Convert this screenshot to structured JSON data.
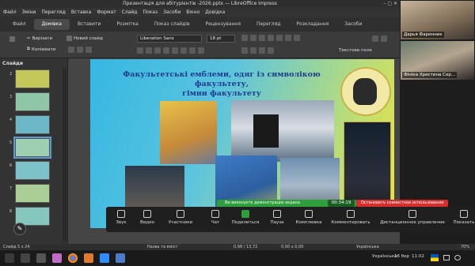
{
  "window": {
    "title": "Презентація для абітурієнтів -2026.pptx — LibreOffice Impress",
    "controls": "–  ▢  ✕"
  },
  "menu": [
    "Файл",
    "Зміни",
    "Перегляд",
    "Вставка",
    "Формат",
    "Слайд",
    "Показ",
    "Засоби",
    "Вікно",
    "Довідка"
  ],
  "tabs": [
    "Файл",
    "Домівка",
    "Вставити",
    "Розмітка",
    "Показ слайдів",
    "Рецензування",
    "Перегляд",
    "Розкладання",
    "Засоби"
  ],
  "toolbar": {
    "cut": "Вирізати",
    "copy": "Копіювати",
    "new_slide": "Новий слайд",
    "font_name": "Liberation Sans",
    "font_size": "18 pt",
    "text_field": "Текстове поле"
  },
  "slides_panel": {
    "heading": "Слайди",
    "thumbs": [
      {
        "num": "2",
        "color": "#c4c858"
      },
      {
        "num": "3",
        "color": "#8fc6a8"
      },
      {
        "num": "4",
        "color": "#6cb8c8"
      },
      {
        "num": "5",
        "color": "#9cd0b0"
      },
      {
        "num": "6",
        "color": "#7ec2c9"
      },
      {
        "num": "7",
        "color": "#a9cf96"
      },
      {
        "num": "8",
        "color": "#86c7bd"
      }
    ],
    "selected": "5"
  },
  "slide": {
    "title_line1": "Факультетські емблеми, одяг із символікою факультету,",
    "title_line2": "гімни факультету"
  },
  "participants": [
    {
      "name": "Дарья Фаринник"
    },
    {
      "name": "Фініка Христина Сер..."
    }
  ],
  "zoom": {
    "share_notice": "Ви виконуєте демонстрацію екрана",
    "timer": "00:34:19",
    "stop_share": "Остановить совместное использование",
    "buttons": [
      "Звук",
      "Видео",
      "Участники",
      "Чат",
      "Поделиться",
      "Пауза",
      "Комплювка",
      "Комментировать",
      "Дистанционное управление",
      "Показать"
    ],
    "participants_count": "2"
  },
  "statusbar": {
    "slide_info": "Слайд 5 з 24",
    "layout": "Назва та вміст",
    "pos": "0,98 / 13,72",
    "size": "0,00 x 0,00",
    "lang": "Українська",
    "zoom": "70%"
  },
  "taskbar": {
    "time": "11:02",
    "date": "16 бер",
    "lang": "Українська",
    "temp": "2°C"
  }
}
